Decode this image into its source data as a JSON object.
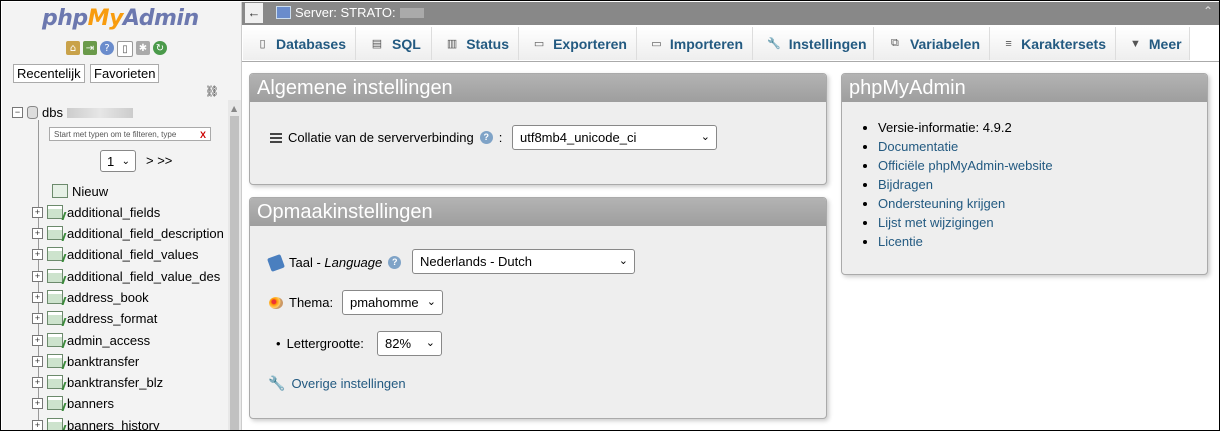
{
  "sidebar": {
    "logo": {
      "php": "php",
      "my": "My",
      "admin": "Admin"
    },
    "quick_icons": [
      "home-icon",
      "exit-icon",
      "help-icon",
      "docs-icon",
      "settings-icon",
      "reload-icon"
    ],
    "tabs": [
      "Recentelijk",
      "Favorieten"
    ],
    "db_name": "dbs",
    "filter_placeholder": "Start met typen om te filteren, type",
    "filter_clear": "X",
    "page_value": "1",
    "page_nav": "> >>",
    "new_label": "Nieuw",
    "tables": [
      "additional_fields",
      "additional_field_description",
      "additional_field_values",
      "additional_field_value_des",
      "address_book",
      "address_format",
      "admin_access",
      "banktransfer",
      "banktransfer_blz",
      "banners",
      "banners_history"
    ]
  },
  "topbar": {
    "back": "←",
    "server_label": "Server: STRATO:"
  },
  "nav": {
    "tabs": [
      {
        "label": "Databases",
        "icon": "database-icon"
      },
      {
        "label": "SQL",
        "icon": "sql-icon"
      },
      {
        "label": "Status",
        "icon": "status-icon"
      },
      {
        "label": "Exporteren",
        "icon": "export-icon"
      },
      {
        "label": "Importeren",
        "icon": "import-icon"
      },
      {
        "label": "Instellingen",
        "icon": "wrench-icon"
      },
      {
        "label": "Variabelen",
        "icon": "variables-icon"
      },
      {
        "label": "Karaktersets",
        "icon": "charset-icon"
      },
      {
        "label": "Meer",
        "icon": "chevron-down-icon"
      }
    ]
  },
  "general": {
    "title": "Algemene instellingen",
    "collation_label": "Collatie van de serververbinding",
    "collation_value": "utf8mb4_unicode_ci"
  },
  "appearance": {
    "title": "Opmaakinstellingen",
    "language_label": "Taal - ",
    "language_label_em": "Language",
    "language_value": "Nederlands - Dutch",
    "theme_label": "Thema:",
    "theme_value": "pmahomme",
    "fontsize_label": "Lettergrootte:",
    "fontsize_value": "82%",
    "more_settings": "Overige instellingen"
  },
  "pma": {
    "title": "phpMyAdmin",
    "version_label": "Versie-informatie: 4.9.2",
    "links": [
      "Documentatie",
      "Officiële phpMyAdmin-website",
      "Bijdragen",
      "Ondersteuning krijgen",
      "Lijst met wijzigingen",
      "Licentie"
    ]
  }
}
